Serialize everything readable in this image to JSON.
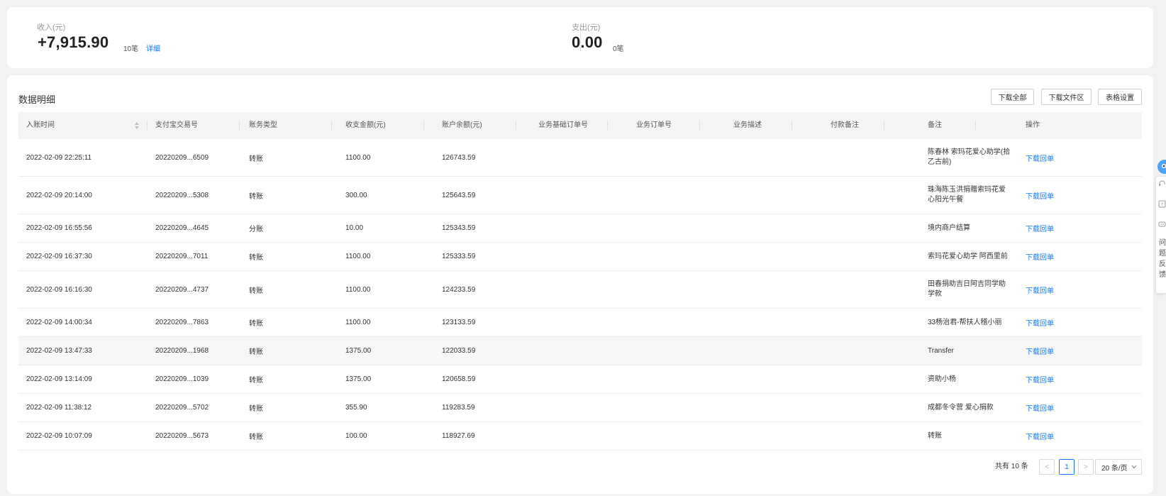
{
  "summary": {
    "income": {
      "label": "收入(元)",
      "amount": "+7,915.90",
      "count": "10笔",
      "detail_link": "详细"
    },
    "expense": {
      "label": "支出(元)",
      "amount": "0.00",
      "count": "0笔"
    }
  },
  "detail": {
    "title": "数据明细",
    "buttons": {
      "download_all": "下载全部",
      "download_files": "下载文件区",
      "table_settings": "表格设置"
    },
    "columns": [
      "入账时间",
      "支付宝交易号",
      "账务类型",
      "收支金额(元)",
      "账户余额(元)",
      "业务基础订单号",
      "业务订单号",
      "业务描述",
      "付款备注",
      "备注",
      "操作"
    ],
    "rows": [
      {
        "time": "2022-02-09 22:25:11",
        "trade_no": "20220209...6509",
        "type": "转账",
        "amount": "1100.00",
        "balance": "126743.59",
        "remark": "陈春林 索玛花爱心助学(拾乙古前)",
        "op": "下载回单"
      },
      {
        "time": "2022-02-09 20:14:00",
        "trade_no": "20220209...5308",
        "type": "转账",
        "amount": "300.00",
        "balance": "125643.59",
        "remark": "珠海陈玉洪捐赠索玛花爱心阳光午餐",
        "op": "下载回单"
      },
      {
        "time": "2022-02-09 16:55:56",
        "trade_no": "20220209...4645",
        "type": "分账",
        "amount": "10.00",
        "balance": "125343.59",
        "remark": "境内商户结算",
        "op": "下载回单"
      },
      {
        "time": "2022-02-09 16:37:30",
        "trade_no": "20220209...7011",
        "type": "转账",
        "amount": "1100.00",
        "balance": "125333.59",
        "remark": "索玛花爱心助学 阿西里前",
        "op": "下载回单"
      },
      {
        "time": "2022-02-09 16:16:30",
        "trade_no": "20220209...4737",
        "type": "转账",
        "amount": "1100.00",
        "balance": "124233.59",
        "remark": "田春捐助吉日阿吉同学助学款",
        "op": "下载回单"
      },
      {
        "time": "2022-02-09 14:00:34",
        "trade_no": "20220209...7863",
        "type": "转账",
        "amount": "1100.00",
        "balance": "123133.59",
        "remark": "33杨治君-帮扶人稽小丽",
        "op": "下载回单"
      },
      {
        "time": "2022-02-09 13:47:33",
        "trade_no": "20220209...1968",
        "type": "转账",
        "amount": "1375.00",
        "balance": "122033.59",
        "remark": "Transfer",
        "op": "下载回单"
      },
      {
        "time": "2022-02-09 13:14:09",
        "trade_no": "20220209...1039",
        "type": "转账",
        "amount": "1375.00",
        "balance": "120658.59",
        "remark": "资助小杨",
        "op": "下载回单"
      },
      {
        "time": "2022-02-09 11:38:12",
        "trade_no": "20220209...5702",
        "type": "转账",
        "amount": "355.90",
        "balance": "119283.59",
        "remark": "成都冬令营 爱心捐款",
        "op": "下载回单"
      },
      {
        "time": "2022-02-09 10:07:09",
        "trade_no": "20220209...5673",
        "type": "转账",
        "amount": "100.00",
        "balance": "118927.69",
        "remark": "转账",
        "op": "下载回单"
      }
    ],
    "pagination": {
      "total": "共有 10 条",
      "prev": "<",
      "page": "1",
      "next": ">",
      "page_size": "20 条/页"
    }
  },
  "side_widget": {
    "text": "问题反馈"
  },
  "colors": {
    "link": "#1677ff",
    "header_bg": "#f5f5f5",
    "page_bg": "#f2f2f2"
  },
  "icons": [
    "sort-icon",
    "chevron-down-icon",
    "robot-assistant-icon",
    "headset-icon",
    "help-icon",
    "chat-icon"
  ]
}
